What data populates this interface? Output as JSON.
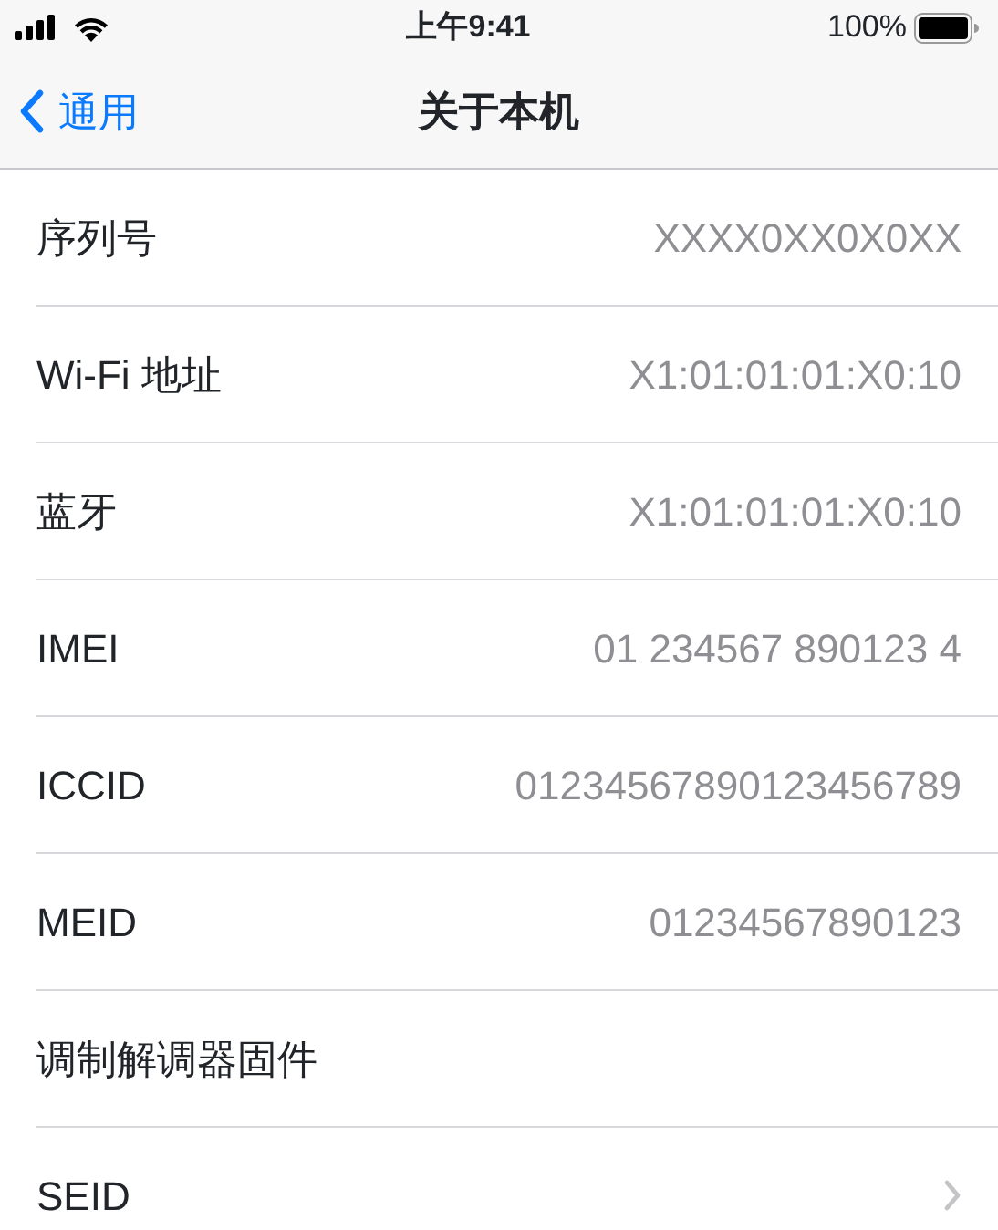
{
  "status_bar": {
    "time": "上午9:41",
    "battery": "100%"
  },
  "nav": {
    "back": "通用",
    "title": "关于本机"
  },
  "rows": [
    {
      "kind": "value",
      "label": "序列号",
      "value": "XXXX0XX0X0XX"
    },
    {
      "kind": "value",
      "label": "Wi-Fi 地址",
      "value": "X1:01:01:01:X0:10"
    },
    {
      "kind": "value",
      "label": "蓝牙",
      "value": "X1:01:01:01:X0:10"
    },
    {
      "kind": "value",
      "label": "IMEI",
      "value": "01 234567 890123 4"
    },
    {
      "kind": "value",
      "label": "ICCID",
      "value": "01234567890123456789"
    },
    {
      "kind": "value",
      "label": "MEID",
      "value": "01234567890123"
    },
    {
      "kind": "value",
      "label": "调制解调器固件"
    },
    {
      "kind": "link",
      "label": "SEID"
    }
  ]
}
